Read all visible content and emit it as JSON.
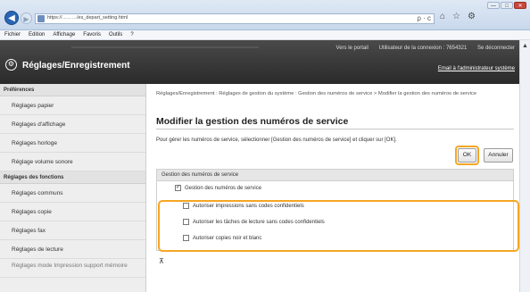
{
  "window_controls": [
    "—",
    "□",
    "✕"
  ],
  "browser": {
    "url": "https://………/es_depart_setting.html",
    "addr_actions": "ρ · c",
    "tools": [
      "⌂",
      "☆",
      "⚙"
    ]
  },
  "menubar": [
    "Fichier",
    "Edition",
    "Affichage",
    "Favoris",
    "Outils",
    "?"
  ],
  "header": {
    "portal_link": "Vers le portail",
    "user_label": "Utilisateur de la connexion : 7654321",
    "logout": "Se déconnecter",
    "title": "Réglages/Enregistrement",
    "email_link": "Email à l'administrateur système"
  },
  "sidebar": {
    "section_preferences": "Préférences",
    "preferences": [
      "Réglages papier",
      "Réglages d'affichage",
      "Réglages horloge",
      "Réglage volume sonore"
    ],
    "section_functions": "Réglages des fonctions",
    "functions": [
      "Réglages communs",
      "Réglages copie",
      "Réglages fax",
      "Réglages de lecture",
      "Réglages mode Impression support mémoire"
    ]
  },
  "main": {
    "breadcrumb": "Réglages/Enregistrement : Réglages de gestion du système : Gestion des numéros de service > Modifier la gestion des numéros de service",
    "title": "Modifier la gestion des numéros de service",
    "intro": "Pour gérer les numéros de service, sélectionner [Gestion des numéros de service] et cliquer sur [OK].",
    "ok_label": "OK",
    "cancel_label": "Annuler",
    "panel_heading": "Gestion des numéros de service",
    "main_checkbox": {
      "label": "Gestion des numéros de service",
      "checked": true
    },
    "options": [
      {
        "label": "Autoriser impressions sans codes confidentiels",
        "checked": false
      },
      {
        "label": "Autoriser les tâches de lecture sans codes confidentiels",
        "checked": false
      },
      {
        "label": "Autoriser copies noir et blanc",
        "checked": false
      }
    ],
    "to_top": "⊼"
  },
  "colors": {
    "highlight": "#f5a623",
    "header_bg": "#333333",
    "link_blue": "#2a66b3"
  }
}
